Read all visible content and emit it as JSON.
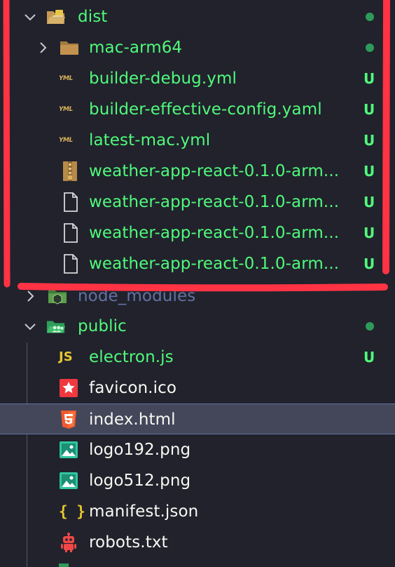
{
  "tree": {
    "dist": {
      "label": "dist"
    },
    "mac_arm64": {
      "label": "mac-arm64"
    },
    "builder_debug": {
      "label": "builder-debug.yml",
      "badge": "U"
    },
    "builder_effective": {
      "label": "builder-effective-config.yaml",
      "badge": "U"
    },
    "latest_mac": {
      "label": "latest-mac.yml",
      "badge": "U"
    },
    "weather_1": {
      "label": "weather-app-react-0.1.0-arm...",
      "badge": "U"
    },
    "weather_2": {
      "label": "weather-app-react-0.1.0-arm...",
      "badge": "U"
    },
    "weather_3": {
      "label": "weather-app-react-0.1.0-arm...",
      "badge": "U"
    },
    "node_modules": {
      "label": "node_modules"
    },
    "public": {
      "label": "public"
    },
    "electron_js": {
      "label": "electron.js",
      "badge": "U"
    },
    "favicon": {
      "label": "favicon.ico"
    },
    "index_html": {
      "label": "index.html"
    },
    "logo192": {
      "label": "logo192.png"
    },
    "logo512": {
      "label": "logo512.png"
    },
    "manifest": {
      "label": "manifest.json"
    },
    "robots": {
      "label": "robots.txt"
    }
  },
  "icons": {
    "yaml_text": "YML",
    "js_text": "JS",
    "braces_text": "{ }"
  },
  "colors": {
    "background": "#21222c",
    "untracked_green": "#50fa7b",
    "folder_dim": "#6272a4",
    "annotation_red": "#ff3344",
    "selected_row": "#44475a"
  }
}
